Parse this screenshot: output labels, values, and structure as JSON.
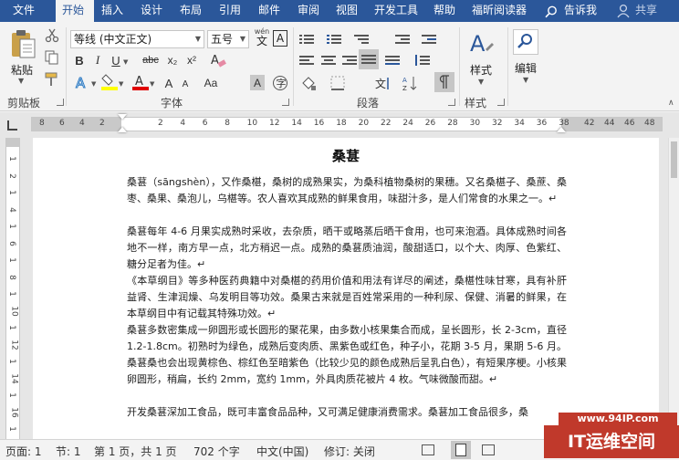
{
  "menu": {
    "file": "文件",
    "tabs": [
      "开始",
      "插入",
      "设计",
      "布局",
      "引用",
      "邮件",
      "审阅",
      "视图",
      "开发工具",
      "帮助",
      "福昕阅读器"
    ],
    "tell_me": "告诉我",
    "share": "共享"
  },
  "ribbon": {
    "clipboard": {
      "paste": "粘贴",
      "group": "剪贴板"
    },
    "font": {
      "font_name": "等线 (中文正文)",
      "font_size": "五号",
      "wen_top": "wén",
      "wen_bottom": "文",
      "bold": "B",
      "italic": "I",
      "underline": "U",
      "strike": "abc",
      "sub": "x₂",
      "sup": "x²",
      "grow": "A",
      "shrink": "A",
      "aa": "Aa",
      "clear": "A",
      "group": "字体"
    },
    "paragraph": {
      "group": "段落"
    },
    "styles": {
      "label": "样式",
      "group": "样式"
    },
    "editing": {
      "label": "编辑"
    }
  },
  "ruler": {
    "h_left": [
      "8",
      "6",
      "4",
      "2"
    ],
    "h_main": [
      "2",
      "4",
      "6",
      "8",
      "10",
      "12",
      "14",
      "16",
      "18",
      "20",
      "22",
      "24",
      "26",
      "28",
      "30",
      "32",
      "34",
      "36",
      "38"
    ],
    "h_right": [
      "42",
      "44",
      "46",
      "48"
    ],
    "v": [
      "1",
      "2",
      "1",
      "4",
      "1",
      "6",
      "1",
      "8",
      "1",
      "10",
      "1",
      "12",
      "1",
      "14",
      "1",
      "16",
      "1"
    ]
  },
  "document": {
    "title": "桑葚",
    "paragraphs": [
      "桑葚（sāngshèn），又作桑椹，桑树的成熟果实，为桑科植物桑树的果穗。又名桑椹子、桑蔗、桑枣、桑果、桑泡儿，乌椹等。农人喜欢其成熟的鲜果食用，味甜汁多，是人们常食的水果之一。↵",
      "桑葚每年 4-6 月果实成熟时采收，去杂质，晒干或略蒸后晒干食用，也可来泡酒。具体成熟时间各地不一样，南方早一点，北方稍迟一点。成熟的桑葚质油润，酸甜适口，以个大、肉厚、色紫红、糖分足者为佳。↵",
      "《本草纲目》等多种医药典籍中对桑椹的药用价值和用法有详尽的阐述，桑椹性味甘寒，具有补肝益肾、生津润燥、乌发明目等功效。桑果古来就是百姓常采用的一种利尿、保健、消暑的鲜果，在本草纲目中有记载其特殊功效。↵",
      "桑葚多数密集成一卵圆形或长圆形的聚花果，由多数小核果集合而成，呈长圆形，长 2-3cm，直径 1.2-1.8cm。初熟时为绿色，成熟后变肉质、黑紫色或红色，种子小，花期 3-5 月，果期 5-6 月。桑葚桑也会出现黄棕色、棕红色至暗紫色（比较少见的颜色成熟后呈乳白色），有短果序梗。小核果卵圆形，稍扁，长约 2mm，宽约 1mm，外具肉质花被片 4 枚。气味微酸而甜。↵",
      "开发桑葚深加工食品，既可丰富食品品种，又可满足健康消费需求。桑葚加工食品很多，桑"
    ]
  },
  "status": {
    "page": "页面: 1",
    "section": "节: 1",
    "page_of": "第 1 页，共 1 页",
    "words": "702 个字",
    "language": "中文(中国)",
    "revision": "修订: 关闭"
  },
  "watermark": {
    "url": "www.94IP.com",
    "brand": "IT运维空间"
  },
  "colors": {
    "accent": "#2b579a",
    "highlight": "#ffff00",
    "font_color": "#e00000"
  }
}
